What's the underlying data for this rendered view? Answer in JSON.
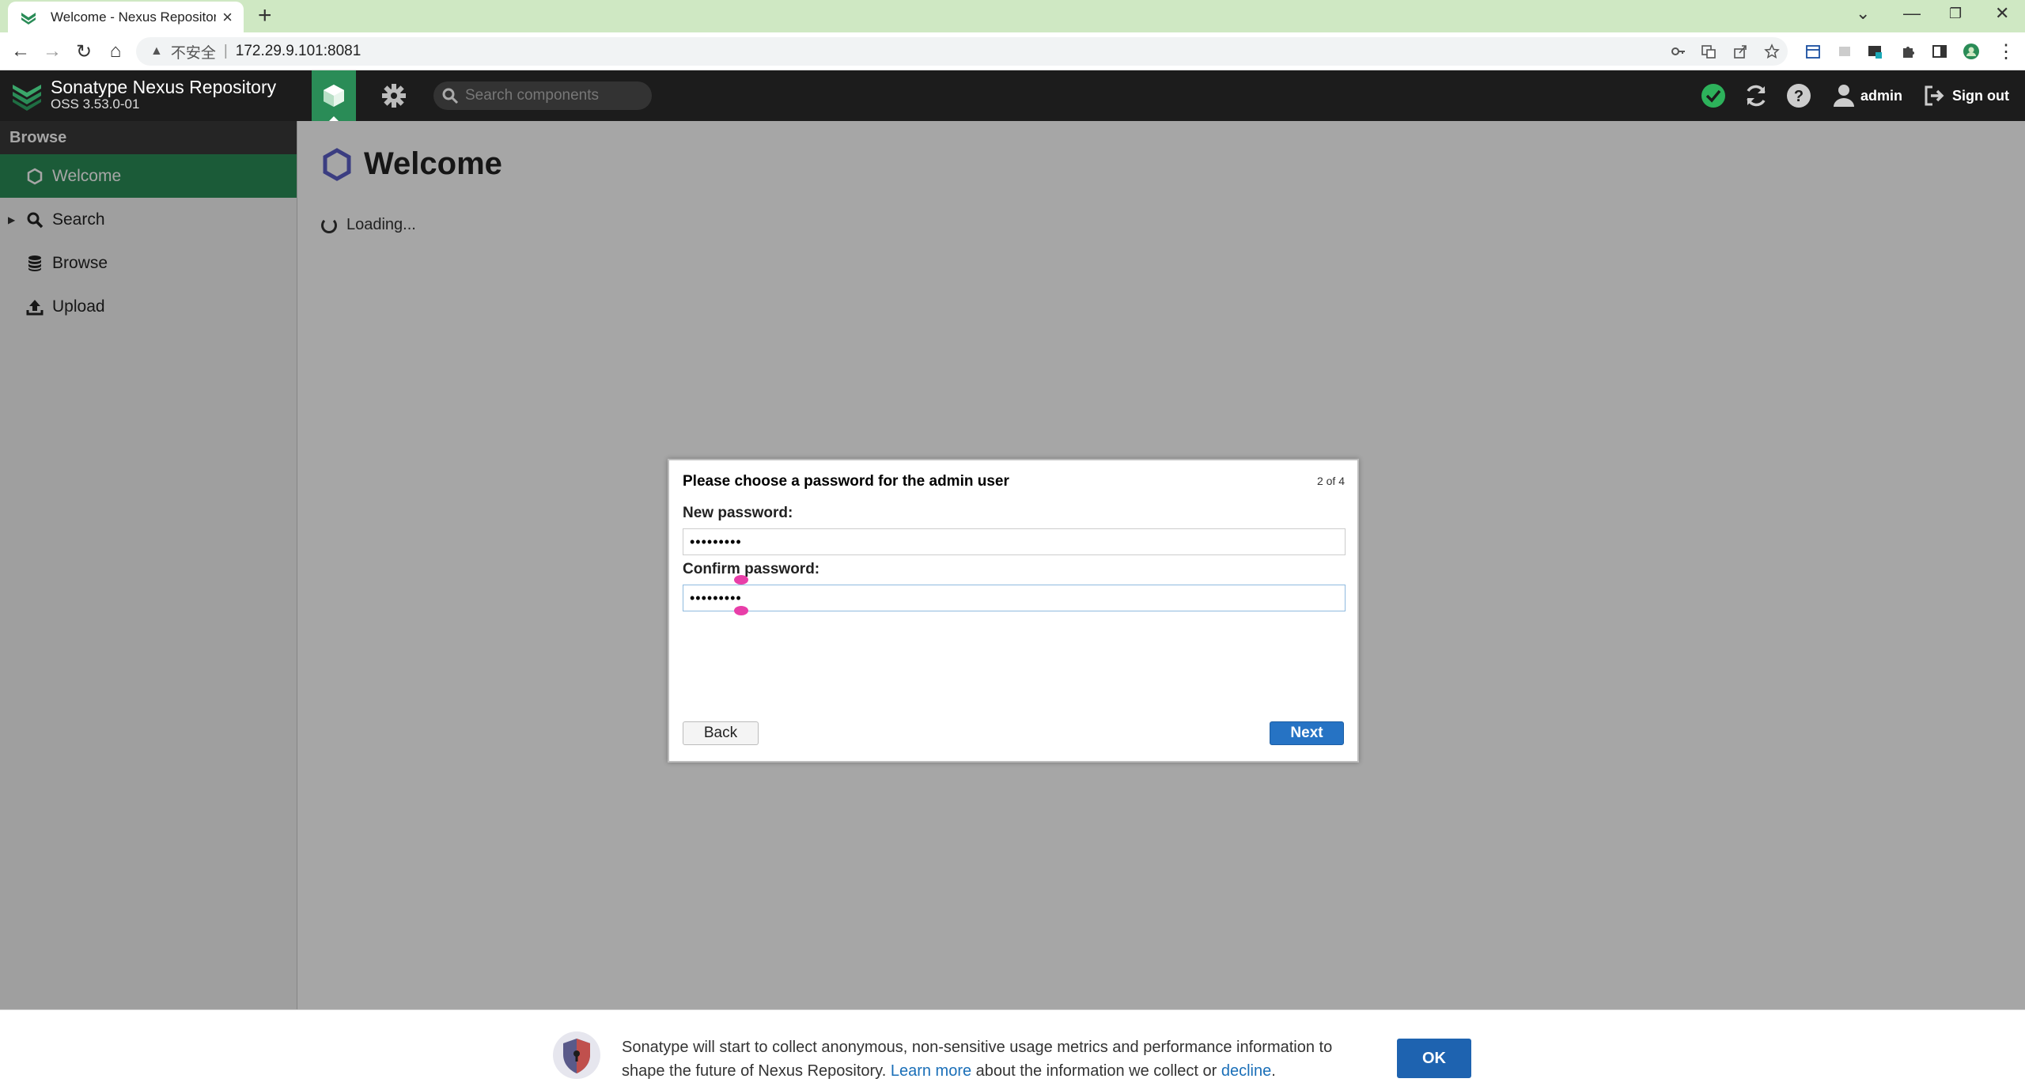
{
  "browser": {
    "tab_title": "Welcome - Nexus Repository M",
    "new_tab": "+",
    "close_tab": "×",
    "security_label": "不安全",
    "separator": "|",
    "url": "172.29.9.101:8081"
  },
  "header": {
    "product_name": "Sonatype Nexus Repository",
    "version": "OSS 3.53.0-01",
    "search_placeholder": "Search components",
    "user_name": "admin",
    "sign_out": "Sign out",
    "accent": "#2a8c57"
  },
  "sidebar": {
    "header": "Browse",
    "items": [
      {
        "label": "Welcome",
        "icon": "hexagon-icon",
        "active": true
      },
      {
        "label": "Search",
        "icon": "search-icon",
        "active": false
      },
      {
        "label": "Browse",
        "icon": "database-icon",
        "active": false
      },
      {
        "label": "Upload",
        "icon": "upload-icon",
        "active": false
      }
    ]
  },
  "main": {
    "title": "Welcome",
    "loading_text": "Loading..."
  },
  "dialog": {
    "title": "Please choose a password for the admin user",
    "step": "2 of 4",
    "new_password_label": "New password:",
    "new_password_value": "•••••••••",
    "confirm_password_label": "Confirm password:",
    "confirm_password_value": "•••••••••",
    "back_label": "Back",
    "next_label": "Next"
  },
  "banner": {
    "text_before": "Sonatype will start to collect anonymous, non-sensitive usage metrics and performance information to shape the future of Nexus Repository.",
    "learn_more": "Learn more",
    "text_middle": "about the information we collect or",
    "decline": "decline",
    "text_end": ".",
    "ok_label": "OK"
  }
}
